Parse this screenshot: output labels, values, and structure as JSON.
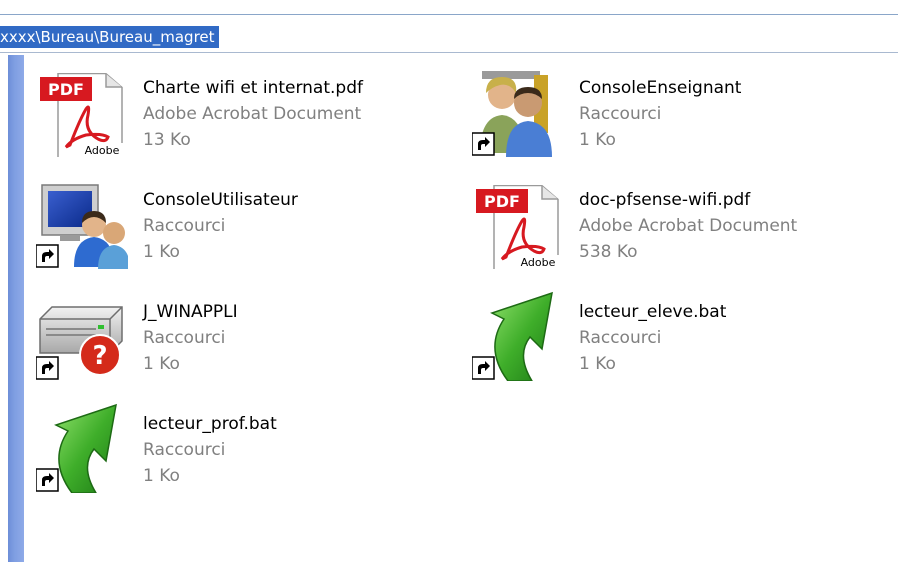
{
  "address": {
    "path": "xxxx\\Bureau\\Bureau_magret"
  },
  "files": [
    {
      "name": "Charte wifi et internat.pdf",
      "type": "Adobe Acrobat Document",
      "size": "13 Ko",
      "icon": "pdf-icon"
    },
    {
      "name": "ConsoleEnseignant",
      "type": "Raccourci",
      "size": "1 Ko",
      "icon": "teacher-users-shortcut-icon"
    },
    {
      "name": "ConsoleUtilisateur",
      "type": "Raccourci",
      "size": "1 Ko",
      "icon": "computer-users-shortcut-icon"
    },
    {
      "name": "doc-pfsense-wifi.pdf",
      "type": "Adobe Acrobat Document",
      "size": "538 Ko",
      "icon": "pdf-icon"
    },
    {
      "name": "J_WINAPPLI",
      "type": "Raccourci",
      "size": "1 Ko",
      "icon": "drive-unknown-shortcut-icon"
    },
    {
      "name": "lecteur_eleve.bat",
      "type": "Raccourci",
      "size": "1 Ko",
      "icon": "green-arrow-shortcut-icon"
    },
    {
      "name": "lecteur_prof.bat",
      "type": "Raccourci",
      "size": "1 Ko",
      "icon": "green-arrow-shortcut-icon"
    }
  ],
  "pdf_logo": {
    "badge": "PDF",
    "brand": "Adobe"
  },
  "colors": {
    "selection": "#316ac5",
    "sidebar": "#7f9ee2",
    "pdf_red": "#d71920",
    "arrow_green": "#3fae2a"
  }
}
